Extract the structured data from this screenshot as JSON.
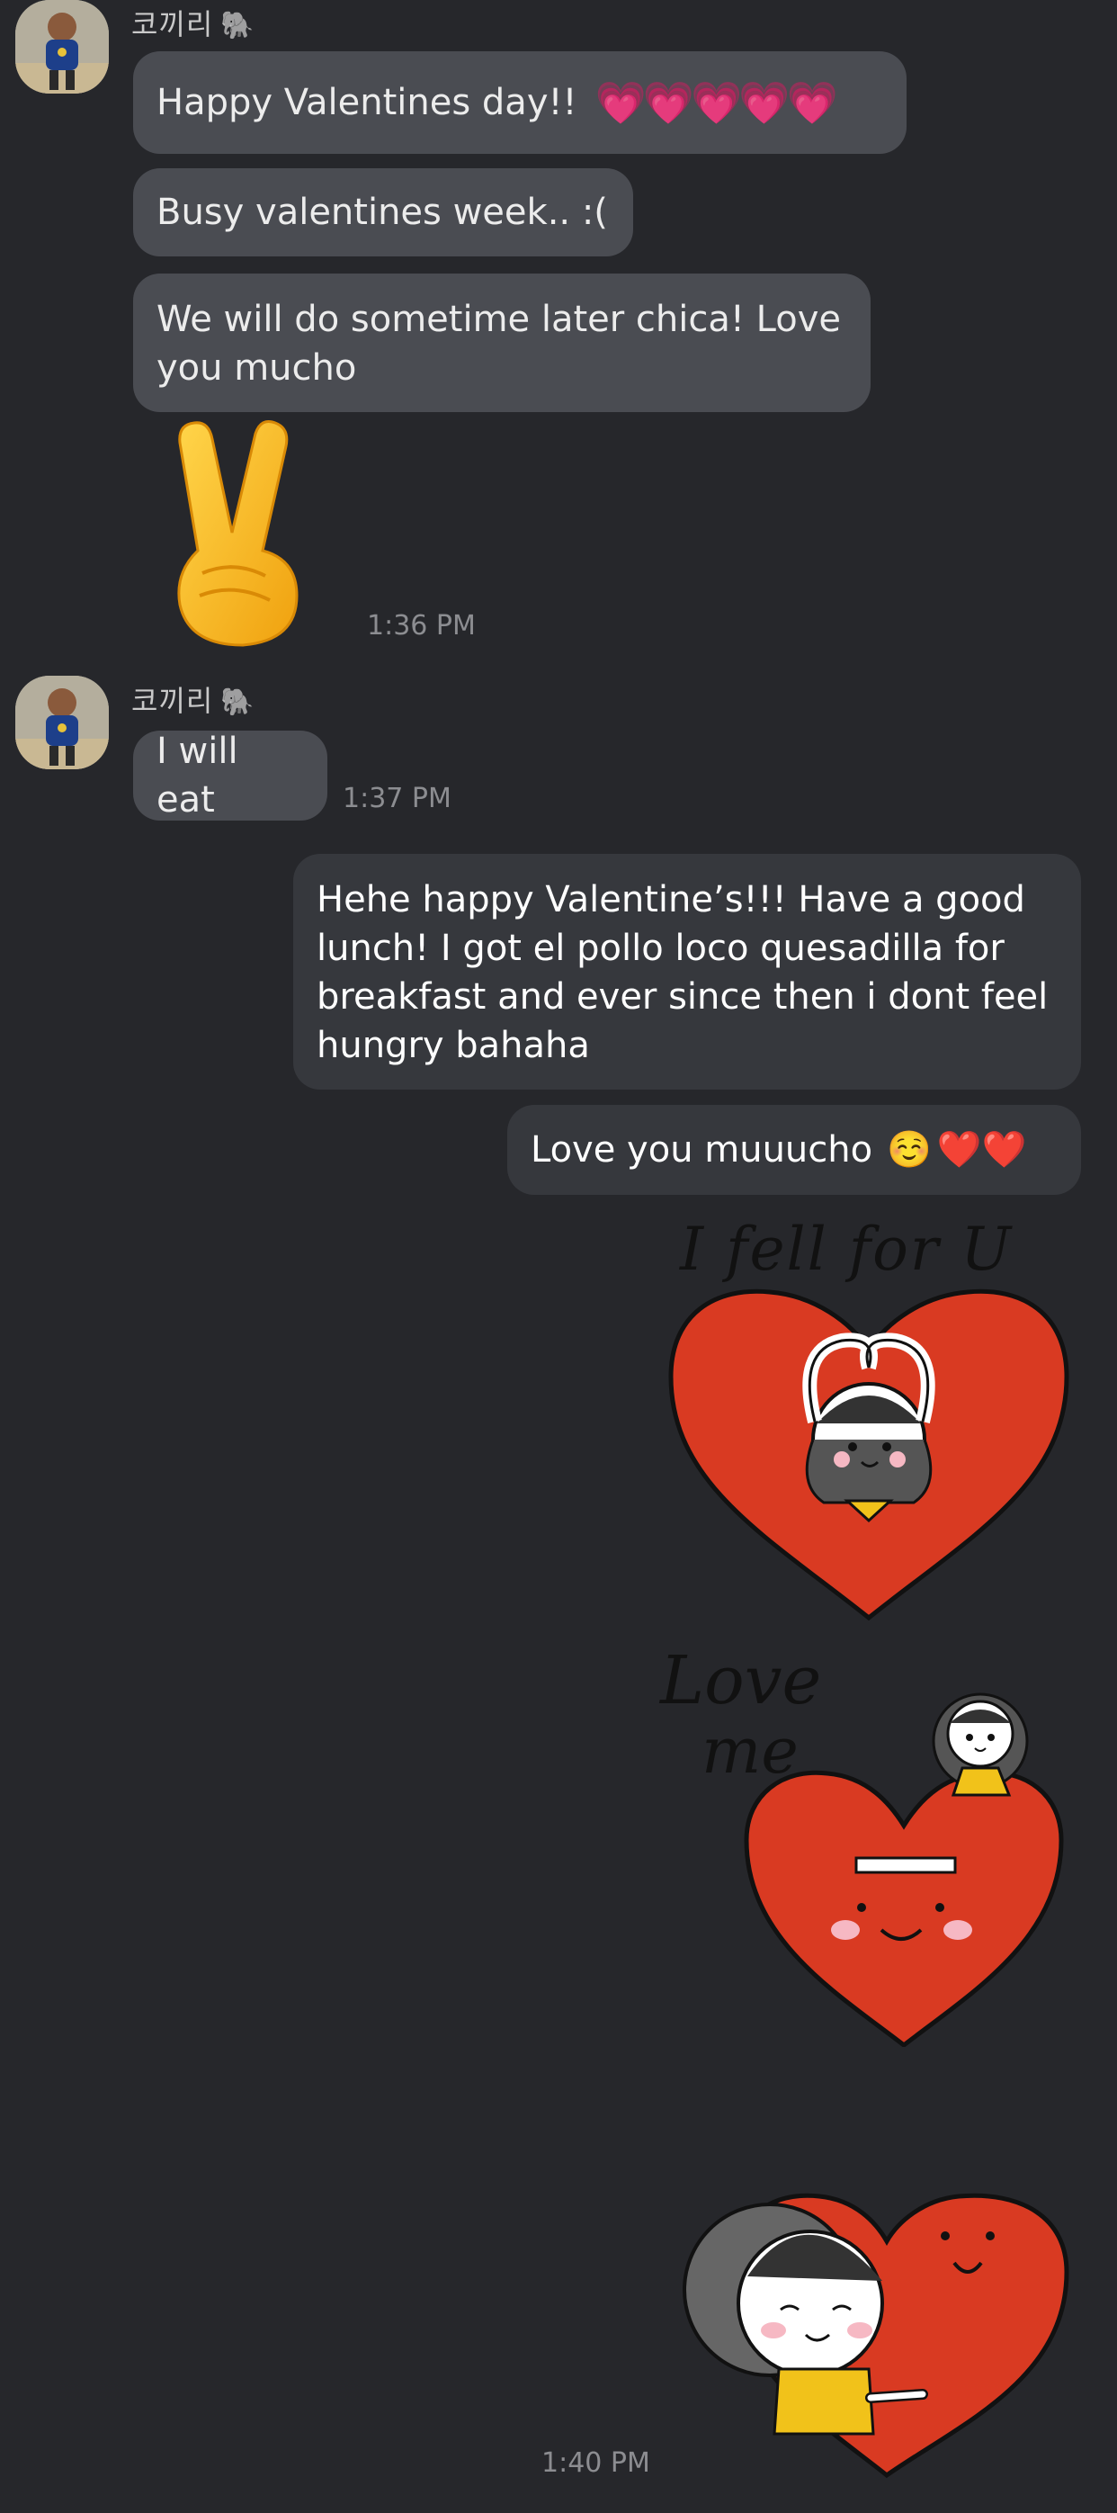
{
  "contact": {
    "name": "코끼리",
    "name_icon": "🐘"
  },
  "messages_in_1": {
    "happy_valentines": "Happy Valentines day!!",
    "hearts": "💗💗💗💗💗",
    "busy": "Busy valentines week.. :(",
    "later_line1": "We will do sometime later chica! Love",
    "later_line2": "you mucho",
    "peace_emoji": "✌️",
    "time": "1:36 PM"
  },
  "messages_in_2": {
    "eat": "I will eat",
    "time": "1:37 PM"
  },
  "messages_out": {
    "hehe_line1": "Hehe happy Valentine’s!!! Have a good",
    "hehe_line2": "lunch! I got el pollo loco quesadilla for",
    "hehe_line3": "breakfast and ever since then i dont feel",
    "hehe_line4": "hungry bahaha",
    "love_text": "Love you muuucho",
    "love_emoji": "☺️",
    "love_hearts": "❤️❤️"
  },
  "stickers": {
    "fell_for_u": "I fell for U",
    "love_line1": "Love",
    "love_line2": "me"
  },
  "final_time": "1:40 PM",
  "colors": {
    "background": "#26272b",
    "bubble_incoming": "#4a4c52",
    "bubble_outgoing": "#36383d",
    "heart_red": "#dd3b25"
  }
}
